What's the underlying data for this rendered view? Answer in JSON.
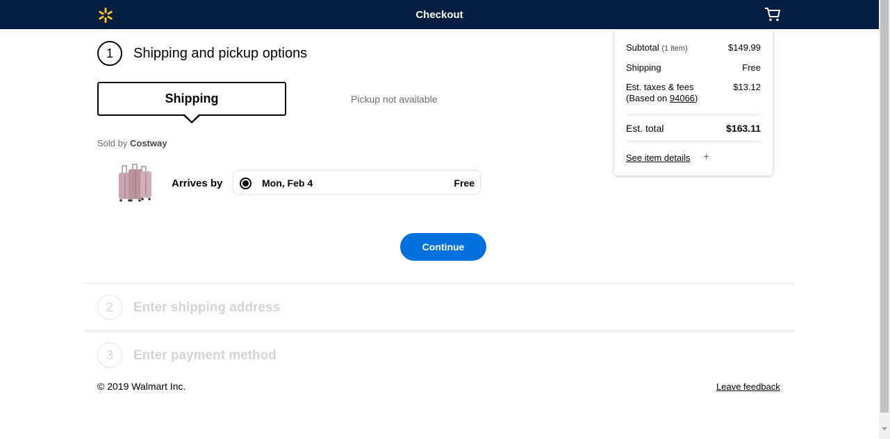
{
  "header": {
    "title": "Checkout",
    "brand_color": "#041e42",
    "spark_color": "#ffc220",
    "logo_icon": "walmart-spark-icon",
    "cart_icon": "cart-icon"
  },
  "step1": {
    "number": "1",
    "title": "Shipping and pickup options",
    "tab_shipping": "Shipping",
    "pickup_label": "Pickup not available",
    "sold_by_prefix": "Sold by",
    "seller": "Costway",
    "arrives_label": "Arrives by",
    "option": {
      "date": "Mon, Feb 4",
      "price": "Free",
      "selected": true
    },
    "continue_label": "Continue",
    "accent_color": "#0071dc"
  },
  "step2": {
    "number": "2",
    "title": "Enter shipping address"
  },
  "step3": {
    "number": "3",
    "title": "Enter payment method"
  },
  "footer": {
    "copyright": "© 2019 Walmart Inc.",
    "feedback": "Leave feedback"
  },
  "summary": {
    "subtotal_label": "Subtotal",
    "subtotal_count": "(1 item)",
    "subtotal_value": "$149.99",
    "shipping_label": "Shipping",
    "shipping_value": "Free",
    "taxes_label": "Est. taxes & fees",
    "taxes_based_prefix": "(Based on ",
    "taxes_zip": "94066",
    "taxes_based_suffix": ")",
    "taxes_value": "$13.12",
    "total_label": "Est. total",
    "total_value": "$163.11",
    "details_link": "See item details",
    "expand_icon": "+"
  }
}
